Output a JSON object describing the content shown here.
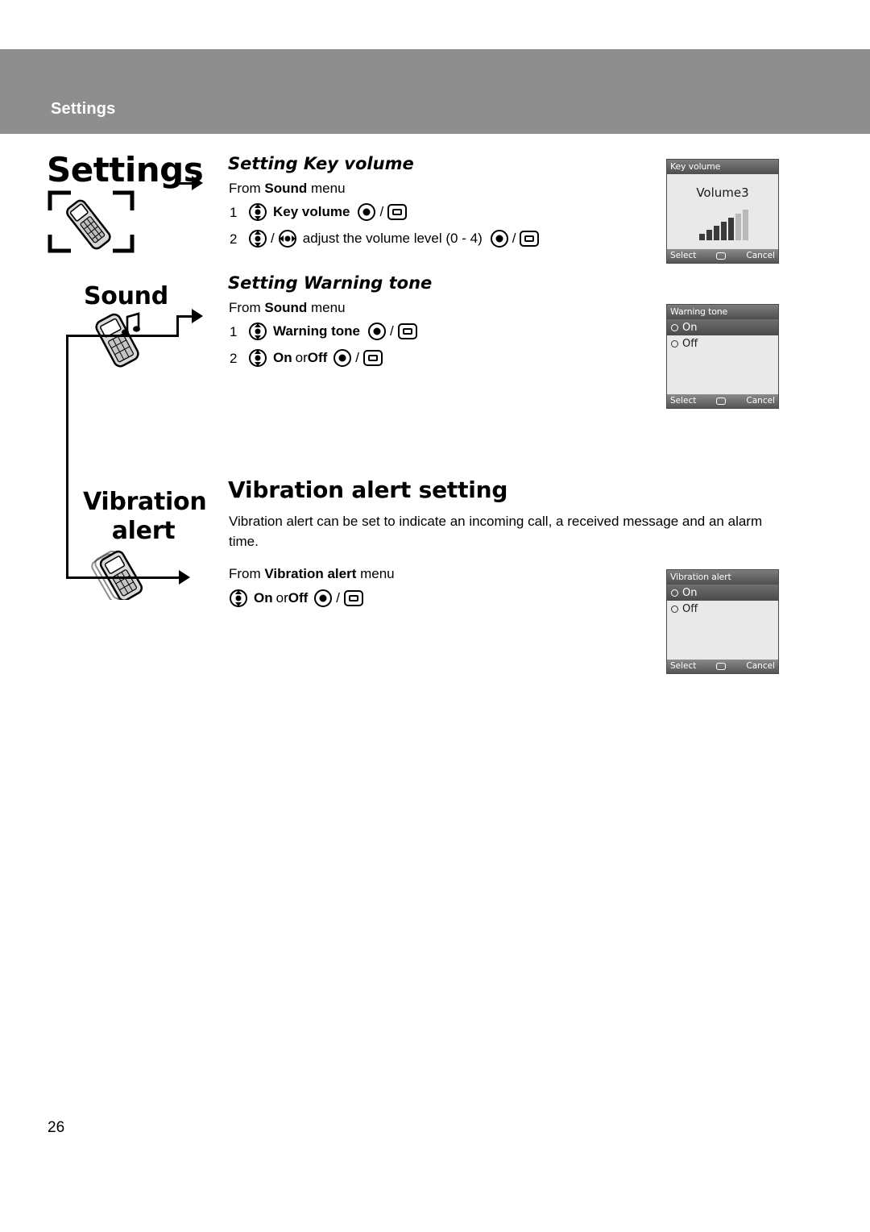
{
  "header": {
    "band_label": "Settings"
  },
  "left_column": {
    "chapter_title": "Settings",
    "sections": [
      {
        "label": "Sound",
        "icon": "phone-music-note-icon"
      },
      {
        "label": "Vibration\nalert",
        "label_line1": "Vibration",
        "label_line2": "alert",
        "icon": "phone-vibrating-icon"
      }
    ],
    "chapter_icon": "phone-in-brackets-icon"
  },
  "content": {
    "key_volume": {
      "heading": "Setting Key volume",
      "from_line_prefix": "From ",
      "from_line_bold": "Sound",
      "from_line_suffix": " menu",
      "steps": [
        {
          "num": "1",
          "icons": [
            "nav-vertical-key-icon"
          ],
          "text": "Key volume",
          "bold": true,
          "after": [
            "select-key-icon",
            "/",
            "softkey-icon"
          ]
        },
        {
          "num": "2",
          "icons": [
            "nav-vertical-key-icon",
            "/",
            "nav-horizontal-key-icon"
          ],
          "text": "adjust the volume level (0 - 4)",
          "bold": false,
          "after": [
            "select-key-icon",
            "/",
            "softkey-icon"
          ]
        }
      ]
    },
    "warning_tone": {
      "heading": "Setting Warning tone",
      "from_line_prefix": "From ",
      "from_line_bold": "Sound",
      "from_line_suffix": " menu",
      "steps": [
        {
          "num": "1",
          "icons": [
            "nav-vertical-key-icon"
          ],
          "text": "Warning tone",
          "bold": true,
          "after": [
            "select-key-icon",
            "/",
            "softkey-icon"
          ]
        },
        {
          "num": "2",
          "icons": [
            "nav-vertical-key-icon"
          ],
          "text_bold_1": "On",
          "text_mid": " or ",
          "text_bold_2": "Off",
          "after": [
            "select-key-icon",
            "/",
            "softkey-icon"
          ]
        }
      ]
    },
    "vibration": {
      "heading": "Vibration alert setting",
      "paragraph": "Vibration alert can be set to indicate an incoming call, a received message and an alarm time.",
      "from_line_prefix": "From ",
      "from_line_bold": "Vibration alert",
      "from_line_suffix": " menu",
      "step": {
        "icons": [
          "nav-vertical-key-icon"
        ],
        "text_bold_1": "On",
        "text_mid": " or ",
        "text_bold_2": "Off",
        "after": [
          "select-key-icon",
          "/",
          "softkey-icon"
        ]
      }
    }
  },
  "screens": [
    {
      "title": "Key volume",
      "type": "volume",
      "value_label": "Volume3",
      "bar_count": 7,
      "softkeys": {
        "left": "Select",
        "right": "Cancel"
      }
    },
    {
      "title": "Warning tone",
      "type": "radio",
      "options": [
        {
          "label": "On",
          "selected": true
        },
        {
          "label": "Off",
          "selected": false
        }
      ],
      "softkeys": {
        "left": "Select",
        "right": "Cancel"
      }
    },
    {
      "title": "Vibration alert",
      "type": "radio",
      "options": [
        {
          "label": "On",
          "selected": true
        },
        {
          "label": "Off",
          "selected": false
        }
      ],
      "softkeys": {
        "left": "Select",
        "right": "Cancel"
      }
    }
  ],
  "page_number": "26",
  "colors": {
    "header_band": "#8e8e8e",
    "screen_bg": "#e9e9e9",
    "screen_bar": "#4e4e4e"
  }
}
